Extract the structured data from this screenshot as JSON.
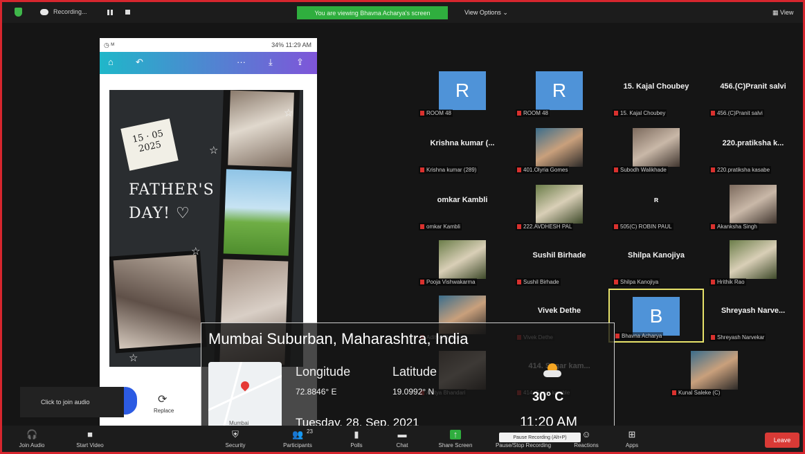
{
  "topbar": {
    "recording_label": "Recording...",
    "viewing_banner": "You are viewing Bhavna Acharya's screen",
    "view_options": "View Options ⌄",
    "view_label": "View"
  },
  "phone": {
    "status_left": "◷ ᴹ",
    "status_right": "34% 11:29 AM",
    "appbar": {
      "home": "⌂",
      "undo": "↶",
      "more": "···",
      "download": "⤓",
      "share": "⇪"
    },
    "sticky_note": "15 · 05\n2025",
    "fathers_line1": "FATHER'S",
    "fathers_line2": "DAY! ♡",
    "replace_label": "Replace"
  },
  "join_audio_popup": "Click to join audio",
  "location": {
    "title": "Mumbai Suburban, Maharashtra, India",
    "longitude_header": "Longitude",
    "longitude_value": "72.8846° E",
    "latitude_header": "Latitude",
    "latitude_value": "19.0992° N",
    "date": "Tuesday, 28, Sep, 2021",
    "temperature": "30° C",
    "time": "11:20 AM",
    "map_label": "Mumbai"
  },
  "participants": [
    {
      "label": "ROOM 48",
      "avatar": "R",
      "avatar_color": "#4f93d8"
    },
    {
      "label": "ROOM 48",
      "avatar": "R",
      "avatar_color": "#4f93d8"
    },
    {
      "label": "15. Kajal Choubey",
      "bigname": "15. Kajal Choubey"
    },
    {
      "label": "456.(C)Pranit salvi",
      "bigname": "456.(C)Pranit salvi"
    },
    {
      "label": "Krishna kumar (289)",
      "bigname": "Krishna kumar (..."
    },
    {
      "label": "401.Olyria Gomes",
      "photo": "photo2"
    },
    {
      "label": "Subodh Walikhade",
      "photo": "photo"
    },
    {
      "label": "220.pratiksha kasabe",
      "bigname": "220.pratiksha k..."
    },
    {
      "label": "omkar Kambli",
      "bigname": "omkar Kambli"
    },
    {
      "label": "222.AVDHESH PAL",
      "photo": "photo3"
    },
    {
      "label": "505(C) ROBIN PAUL",
      "bigname": "ʀ"
    },
    {
      "label": "Akanksha Singh",
      "photo": "photo"
    },
    {
      "label": "Pooja Vishwakarma",
      "photo": "photo3"
    },
    {
      "label": "Sushil Birhade",
      "bigname": "Sushil Birhade"
    },
    {
      "label": "Shilpa Kanojiya",
      "bigname": "Shilpa Kanojiya"
    },
    {
      "label": "Hrithik Rao",
      "photo": "photo3"
    },
    {
      "label": "Aditya Bhandari",
      "photo": "photo2"
    },
    {
      "label": "Vivek Dethe",
      "bigname": "Vivek Dethe"
    },
    {
      "label": "Bhavna Acharya",
      "avatar": "B",
      "avatar_color": "#4f93d8"
    },
    {
      "label": "Shreyash Narvekar",
      "bigname": "Shreyash Narve..."
    },
    {
      "label": "Aditya Bhandari",
      "photo": "photo"
    },
    {
      "label": "414. Sagar kamble",
      "bigname": "414. Sagar kam..."
    },
    {
      "label": "Kunal Saleke (C)",
      "photo": "photo2"
    }
  ],
  "toolbar": {
    "join_audio": "Join Audio",
    "start_video": "Start Video",
    "security": "Security",
    "participants": "Participants",
    "participants_count": "23",
    "polls": "Polls",
    "chat": "Chat",
    "share_screen": "Share Screen",
    "pause_stop_recording": "Pause/Stop Recording",
    "reactions": "Reactions",
    "apps": "Apps",
    "leave": "Leave",
    "tooltip": "Pause Recording (Alt+P)"
  }
}
